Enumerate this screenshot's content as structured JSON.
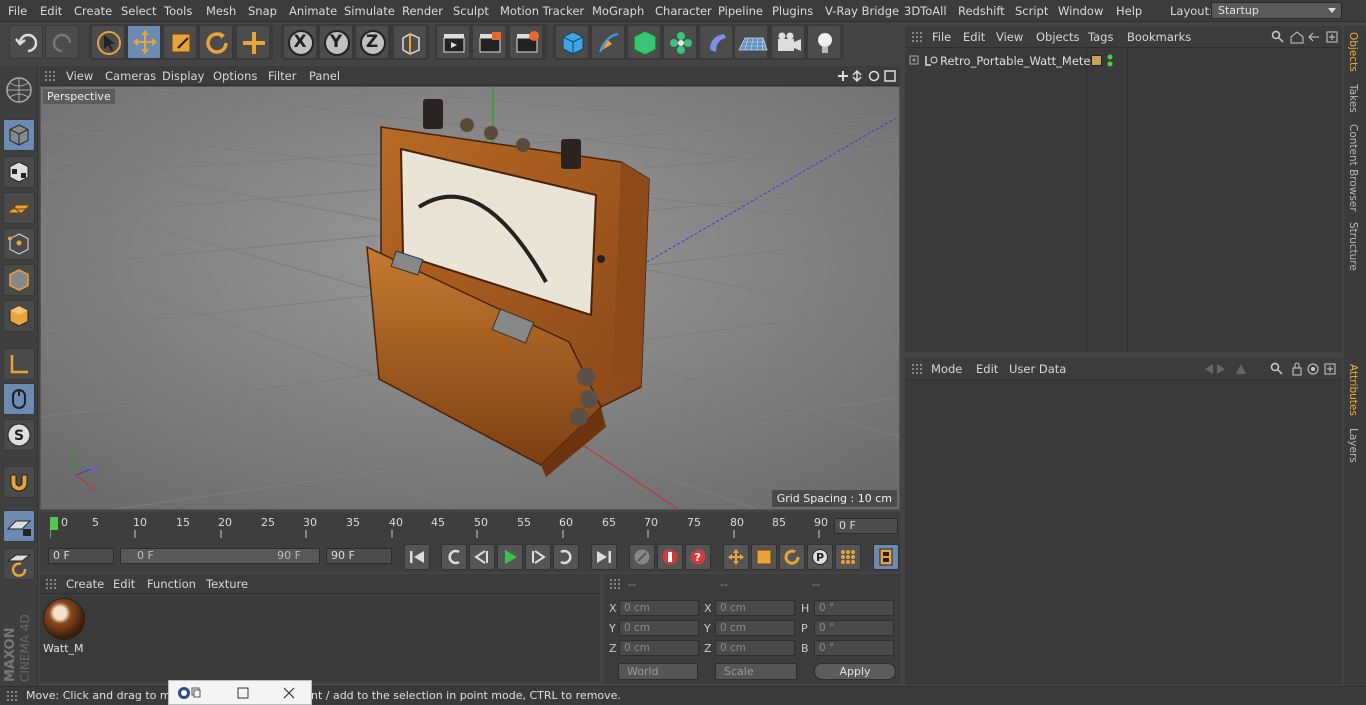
{
  "menu": [
    "File",
    "Edit",
    "Create",
    "Select",
    "Tools",
    "Mesh",
    "Snap",
    "Animate",
    "Simulate",
    "Render",
    "Sculpt",
    "Motion Tracker",
    "MoGraph",
    "Character",
    "Pipeline",
    "Plugins",
    "V-Ray Bridge",
    "3DToAll",
    "Redshift",
    "Script",
    "Window",
    "Help"
  ],
  "layout": {
    "label": "Layout:",
    "value": "Startup"
  },
  "toolbar": {
    "axis_x": "X",
    "axis_y": "Y",
    "axis_z": "Z"
  },
  "viewport": {
    "menu": [
      "View",
      "Cameras",
      "Display",
      "Options",
      "Filter",
      "Panel"
    ],
    "label": "Perspective",
    "grid_spacing": "Grid Spacing : 10 cm",
    "axis_labels": {
      "x": "X",
      "y": "Y",
      "z": "Z"
    }
  },
  "timeline": {
    "ticks": [
      "0",
      "5",
      "10",
      "15",
      "20",
      "25",
      "30",
      "35",
      "40",
      "45",
      "50",
      "55",
      "60",
      "65",
      "70",
      "75",
      "80",
      "85",
      "90"
    ],
    "current_frame": "0 F"
  },
  "transport": {
    "start_field": "0 F",
    "range_start": "0 F",
    "range_end": "90 F",
    "end_field": "90 F"
  },
  "materials": {
    "menu": [
      "Create",
      "Edit",
      "Function",
      "Texture"
    ],
    "item_name": "Watt_M"
  },
  "coordinates": {
    "headers": [
      "--",
      "--",
      "--"
    ],
    "rows": [
      {
        "l1": "X",
        "v1": "0 cm",
        "l2": "X",
        "v2": "0 cm",
        "l3": "H",
        "v3": "0 °"
      },
      {
        "l1": "Y",
        "v1": "0 cm",
        "l2": "Y",
        "v2": "0 cm",
        "l3": "P",
        "v3": "0 °"
      },
      {
        "l1": "Z",
        "v1": "0 cm",
        "l2": "Z",
        "v2": "0 cm",
        "l3": "B",
        "v3": "0 °"
      }
    ],
    "world": "World",
    "scale": "Scale",
    "apply": "Apply"
  },
  "objects": {
    "menu": [
      "File",
      "Edit",
      "View",
      "Objects",
      "Tags",
      "Bookmarks"
    ],
    "item": "Retro_Portable_Watt_Meter"
  },
  "attributes": {
    "menu": [
      "Mode",
      "Edit",
      "User Data"
    ]
  },
  "side_tabs": [
    "Objects",
    "Takes",
    "Content Browser",
    "Structure",
    "Attributes",
    "Layers"
  ],
  "status": "Move: Click and drag to mo                    FT to quantize movement / add to the selection in point mode, CTRL to remove.",
  "brand": {
    "line1": "MAXON",
    "line2": "CINEMA 4D"
  },
  "colors": {
    "accent": "#e8a43a",
    "active": "#6d8ab3",
    "model": "#b4611f"
  }
}
